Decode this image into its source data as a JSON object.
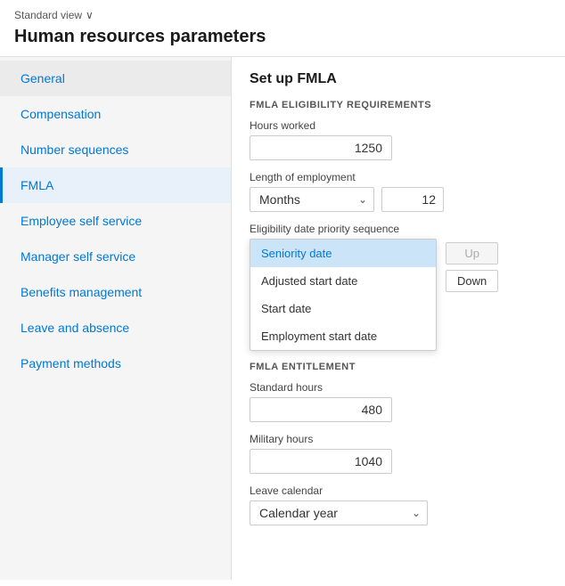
{
  "topbar": {
    "view_label": "Standard view",
    "chevron": "∨"
  },
  "page": {
    "title": "Human resources parameters"
  },
  "sidebar": {
    "items": [
      {
        "id": "general",
        "label": "General",
        "active": true
      },
      {
        "id": "compensation",
        "label": "Compensation",
        "active": false
      },
      {
        "id": "number-sequences",
        "label": "Number sequences",
        "active": false
      },
      {
        "id": "fmla",
        "label": "FMLA",
        "active": false,
        "highlight": true
      },
      {
        "id": "employee-self-service",
        "label": "Employee self service",
        "active": false
      },
      {
        "id": "manager-self-service",
        "label": "Manager self service",
        "active": false
      },
      {
        "id": "benefits-management",
        "label": "Benefits management",
        "active": false
      },
      {
        "id": "leave-and-absence",
        "label": "Leave and absence",
        "active": false
      },
      {
        "id": "payment-methods",
        "label": "Payment methods",
        "active": false
      }
    ]
  },
  "content": {
    "section_title": "Set up FMLA",
    "eligibility": {
      "subsection_label": "FMLA ELIGIBILITY REQUIREMENTS",
      "hours_worked_label": "Hours worked",
      "hours_worked_value": "1250",
      "employment_length_label": "Length of employment",
      "employment_length_option": "Months",
      "employment_length_number": "12",
      "priority_label": "Eligibility date priority sequence",
      "priority_options": [
        {
          "label": "Seniority date",
          "selected": true
        },
        {
          "label": "Adjusted start date",
          "selected": false
        },
        {
          "label": "Start date",
          "selected": false
        },
        {
          "label": "Employment start date",
          "selected": false
        }
      ],
      "btn_up": "Up",
      "btn_down": "Down"
    },
    "entitlement": {
      "subsection_label": "FMLA ENTITLEMENT",
      "standard_hours_label": "Standard hours",
      "standard_hours_value": "480",
      "military_hours_label": "Military hours",
      "military_hours_value": "1040",
      "leave_calendar_label": "Leave calendar",
      "leave_calendar_option": "Calendar year"
    }
  }
}
